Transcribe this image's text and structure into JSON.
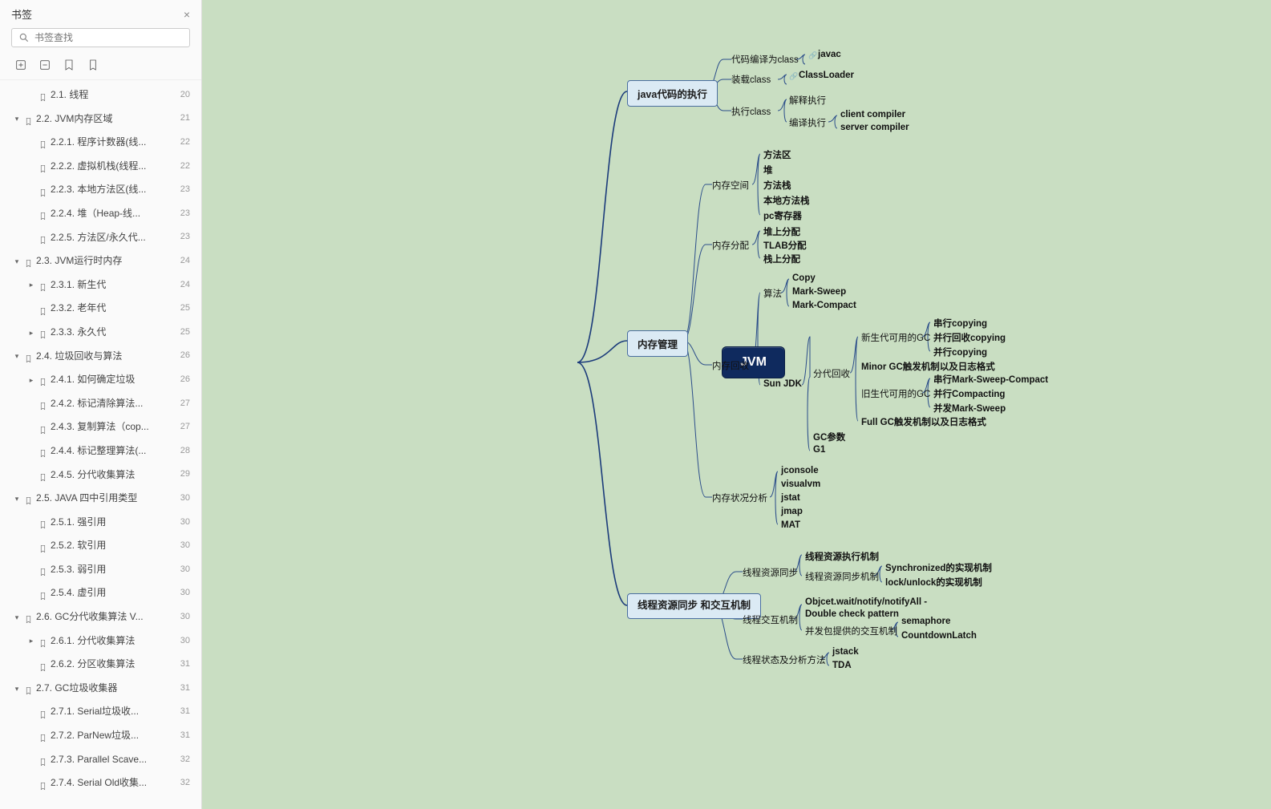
{
  "sidebar": {
    "title": "书签",
    "search_placeholder": "书签查找",
    "items": [
      {
        "depth": 1,
        "tw": "",
        "label": "2.1. 线程",
        "page": 20
      },
      {
        "depth": 0,
        "tw": "▾",
        "label": "2.2. JVM内存区域",
        "page": 21
      },
      {
        "depth": 1,
        "tw": "",
        "label": "2.2.1. 程序计数器(线...",
        "page": 22
      },
      {
        "depth": 1,
        "tw": "",
        "label": "2.2.2. 虚拟机栈(线程...",
        "page": 22
      },
      {
        "depth": 1,
        "tw": "",
        "label": "2.2.3. 本地方法区(线...",
        "page": 23
      },
      {
        "depth": 1,
        "tw": "",
        "label": "2.2.4. 堆（Heap-线...",
        "page": 23
      },
      {
        "depth": 1,
        "tw": "",
        "label": "2.2.5. 方法区/永久代...",
        "page": 23
      },
      {
        "depth": 0,
        "tw": "▾",
        "label": "2.3. JVM运行时内存",
        "page": 24
      },
      {
        "depth": 1,
        "tw": "▸",
        "label": "2.3.1. 新生代",
        "page": 24
      },
      {
        "depth": 1,
        "tw": "",
        "label": "2.3.2. 老年代",
        "page": 25
      },
      {
        "depth": 1,
        "tw": "▸",
        "label": "2.3.3. 永久代",
        "page": 25
      },
      {
        "depth": 0,
        "tw": "▾",
        "label": "2.4. 垃圾回收与算法",
        "page": 26
      },
      {
        "depth": 1,
        "tw": "▸",
        "label": "2.4.1. 如何确定垃圾",
        "page": 26
      },
      {
        "depth": 1,
        "tw": "",
        "label": "2.4.2. 标记清除算法...",
        "page": 27
      },
      {
        "depth": 1,
        "tw": "",
        "label": "2.4.3. 复制算法（cop...",
        "page": 27
      },
      {
        "depth": 1,
        "tw": "",
        "label": "2.4.4. 标记整理算法(...",
        "page": 28
      },
      {
        "depth": 1,
        "tw": "",
        "label": "2.4.5. 分代收集算法",
        "page": 29
      },
      {
        "depth": 0,
        "tw": "▾",
        "label": "2.5. JAVA 四中引用类型",
        "page": 30
      },
      {
        "depth": 1,
        "tw": "",
        "label": "2.5.1. 强引用",
        "page": 30
      },
      {
        "depth": 1,
        "tw": "",
        "label": "2.5.2. 软引用",
        "page": 30
      },
      {
        "depth": 1,
        "tw": "",
        "label": "2.5.3. 弱引用",
        "page": 30
      },
      {
        "depth": 1,
        "tw": "",
        "label": "2.5.4. 虚引用",
        "page": 30
      },
      {
        "depth": 0,
        "tw": "▾",
        "label": "2.6. GC分代收集算法  V...",
        "page": 30
      },
      {
        "depth": 1,
        "tw": "▸",
        "label": "2.6.1. 分代收集算法",
        "page": 30
      },
      {
        "depth": 1,
        "tw": "",
        "label": "2.6.2. 分区收集算法",
        "page": 31
      },
      {
        "depth": 0,
        "tw": "▾",
        "label": "2.7. GC垃圾收集器",
        "page": 31
      },
      {
        "depth": 1,
        "tw": "",
        "label": "2.7.1.  Serial垃圾收...",
        "page": 31
      },
      {
        "depth": 1,
        "tw": "",
        "label": "2.7.2.  ParNew垃圾...",
        "page": 31
      },
      {
        "depth": 1,
        "tw": "",
        "label": "2.7.3. Parallel Scave...",
        "page": 32
      },
      {
        "depth": 1,
        "tw": "",
        "label": "2.7.4. Serial Old收集...",
        "page": 32
      }
    ]
  },
  "mindmap": {
    "root": "JVM",
    "branch1": {
      "label": "java代码的执行",
      "items": {
        "a": {
          "label": "代码编译为class",
          "children": [
            "javac"
          ]
        },
        "b": {
          "label": "装载class",
          "children": [
            "ClassLoader"
          ]
        },
        "c": {
          "label": "执行class",
          "children": [
            {
              "label": "解释执行"
            },
            {
              "label": "编译执行",
              "children": [
                "client compiler",
                "server compiler"
              ]
            }
          ]
        }
      }
    },
    "branch2": {
      "label": "内存管理",
      "items": {
        "space": {
          "label": "内存空间",
          "children": [
            "方法区",
            "堆",
            "方法栈",
            "本地方法栈",
            "pc寄存器"
          ]
        },
        "alloc": {
          "label": "内存分配",
          "children": [
            "堆上分配",
            "TLAB分配",
            "栈上分配"
          ]
        },
        "gc": {
          "label": "内存回收",
          "children": {
            "algo": {
              "label": "算法",
              "children": [
                "Copy",
                "Mark-Sweep",
                "Mark-Compact"
              ]
            },
            "sunjdk": {
              "label": "Sun JDK",
              "children": {
                "gen": {
                  "label": "分代回收",
                  "children": {
                    "new": {
                      "label": "新生代可用的GC",
                      "children": [
                        "串行copying",
                        "并行回收copying",
                        "并行copying"
                      ]
                    },
                    "minor": "Minor GC触发机制以及日志格式",
                    "old": {
                      "label": "旧生代可用的GC",
                      "children": [
                        "串行Mark-Sweep-Compact",
                        "并行Compacting",
                        "并发Mark-Sweep"
                      ]
                    },
                    "full": "Full GC触发机制以及日志格式"
                  }
                },
                "gcparam": "GC参数",
                "g1": "G1"
              }
            }
          }
        },
        "analysis": {
          "label": "内存状况分析",
          "children": [
            "jconsole",
            "visualvm",
            "jstat",
            "jmap",
            "MAT"
          ]
        }
      }
    },
    "branch3": {
      "label": "线程资源同步\n和交互机制",
      "items": {
        "sync": {
          "label": "线程资源同步",
          "children": [
            "线程资源执行机制",
            {
              "label": "线程资源同步机制",
              "children": [
                "Synchronized的实现机制",
                "lock/unlock的实现机制"
              ]
            }
          ]
        },
        "interact": {
          "label": "线程交互机制",
          "children": [
            "Objcet.wait/notify/notifyAll - Double check pattern",
            {
              "label": "并发包提供的交互机制",
              "children": [
                "semaphore",
                "CountdownLatch"
              ]
            }
          ]
        },
        "status": {
          "label": "线程状态及分析方法",
          "children": [
            "jstack",
            "TDA"
          ]
        }
      }
    }
  }
}
